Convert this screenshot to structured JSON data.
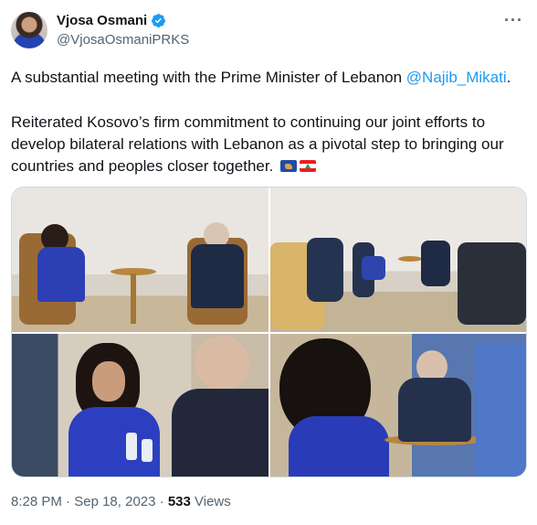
{
  "author": {
    "display_name": "Vjosa Osmani",
    "handle": "@VjosaOsmaniPRKS",
    "verified_color": "#1d9bf0"
  },
  "tweet": {
    "text_before_mention": "A substantial meeting with the Prime Minister of Lebanon ",
    "mention": "@Najib_Mikati",
    "text_after_mention": ".",
    "paragraph2": "Reiterated Kosovo’s firm commitment to continuing our joint efforts to develop bilateral relations with Lebanon as a pivotal step to bringing our countries and peoples closer together.",
    "flags": [
      "kosovo-flag",
      "lebanon-flag"
    ]
  },
  "meta": {
    "time": "8:28 PM",
    "separator": "·",
    "date": "Sep 18, 2023",
    "views_count": "533",
    "views_label": "Views"
  },
  "colors": {
    "link": "#1d9bf0",
    "secondary_text": "#536471",
    "primary_text": "#0f1419"
  }
}
